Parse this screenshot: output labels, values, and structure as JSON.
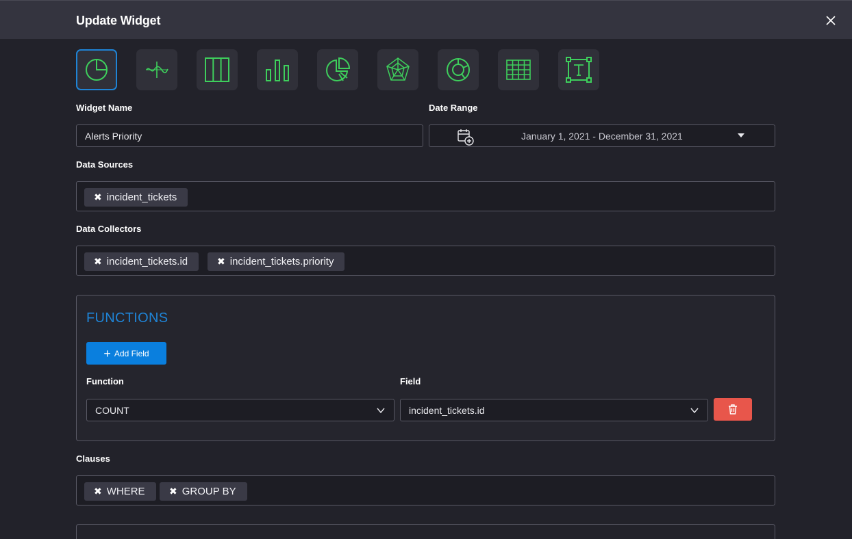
{
  "dialog": {
    "title": "Update Widget"
  },
  "widget_types": [
    {
      "name": "pie",
      "icon": "pie-chart-icon",
      "selected": true
    },
    {
      "name": "line",
      "icon": "line-chart-icon",
      "selected": false
    },
    {
      "name": "columns",
      "icon": "columns-chart-icon",
      "selected": false
    },
    {
      "name": "bar",
      "icon": "bar-chart-icon",
      "selected": false
    },
    {
      "name": "exploded-pie",
      "icon": "exploded-pie-chart-icon",
      "selected": false
    },
    {
      "name": "radar",
      "icon": "radar-chart-icon",
      "selected": false
    },
    {
      "name": "donut",
      "icon": "donut-chart-icon",
      "selected": false
    },
    {
      "name": "table",
      "icon": "table-icon",
      "selected": false
    },
    {
      "name": "text",
      "icon": "text-box-icon",
      "selected": false
    }
  ],
  "form": {
    "widget_name_label": "Widget Name",
    "widget_name_value": "Alerts Priority",
    "date_range_label": "Date Range",
    "date_range_value": "January 1, 2021 - December 31, 2021",
    "data_sources_label": "Data Sources",
    "data_sources": [
      "incident_tickets"
    ],
    "data_collectors_label": "Data Collectors",
    "data_collectors": [
      "incident_tickets.id",
      "incident_tickets.priority"
    ],
    "clauses_label": "Clauses",
    "clauses": [
      "WHERE",
      "GROUP BY"
    ]
  },
  "functions": {
    "title": "FUNCTIONS",
    "add_field_label": "Add Field",
    "function_label": "Function",
    "field_label": "Field",
    "function_value": "COUNT",
    "field_value": "incident_tickets.id"
  },
  "colors": {
    "accent": "#1f84d6",
    "icon_green": "#3ecf5c",
    "delete": "#e8564b"
  }
}
